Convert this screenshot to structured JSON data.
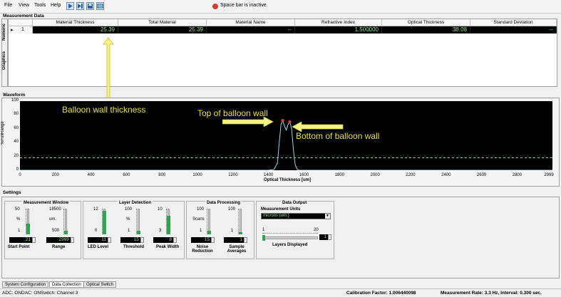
{
  "menu": {
    "file": "File",
    "view": "View",
    "tools": "Tools",
    "help": "Help"
  },
  "toolbar": {
    "icons": [
      "play-icon",
      "step-icon",
      "save-icon",
      "export-icon"
    ]
  },
  "status": {
    "text": "Space bar is inactive.",
    "dot_color": "#d93b2b"
  },
  "measurement_data": {
    "section_label": "Measurement Data",
    "tabs": {
      "numeric": "Numeric",
      "graphics": "Graphics"
    },
    "row_index": "1",
    "columns": [
      "Material Thickness",
      "Total Material",
      "Material Name",
      "Refractive Index",
      "Optical Thickness",
      "Standard Deviation"
    ],
    "values": [
      "25.39",
      "25.39",
      "--",
      "1.500000",
      "38.08",
      "--"
    ],
    "value_color": "#8fe08f"
  },
  "waveform": {
    "section_label": "Waveform",
    "annotations": {
      "wall_thickness": "Balloon wall thickness",
      "top": "Top of balloon wall",
      "bottom": "Bottom of balloon wall"
    },
    "annotation_color": "#e6e22a"
  },
  "chart_data": {
    "type": "line",
    "xlabel": "Optical Thickness [um]",
    "ylabel": "%FullRange",
    "xlim": [
      0,
      2999
    ],
    "ylim": [
      0,
      100
    ],
    "x_ticks": [
      "0",
      "200",
      "400",
      "600",
      "800",
      "1000",
      "1200",
      "1400",
      "1600",
      "1800",
      "2000",
      "2200",
      "2400",
      "2600",
      "2800",
      "2999"
    ],
    "y_ticks": [
      "0",
      "20",
      "40",
      "60",
      "80",
      "100"
    ],
    "threshold": 18,
    "series": [
      {
        "x": [
          0,
          1400,
          1430,
          1450,
          1460,
          1470,
          1480,
          1490,
          1500,
          1510,
          1520,
          1530,
          1540,
          1550,
          1560,
          1570,
          1580,
          2999
        ],
        "y": [
          0,
          0,
          1,
          10,
          40,
          66,
          72,
          64,
          58,
          66,
          70,
          60,
          30,
          8,
          2,
          0,
          0,
          0
        ]
      }
    ],
    "peaks": [
      {
        "x": 1480,
        "y": 72
      },
      {
        "x": 1520,
        "y": 70
      }
    ],
    "line_color": "#8fd6f0",
    "peak_color": "#e04040"
  },
  "settings": {
    "section_label": "Settings",
    "measurement_window": {
      "title": "Measurement Window",
      "start": {
        "label": "Start Point",
        "unit": "%",
        "max": "50",
        "min": "1",
        "value": "21",
        "level": 0.42
      },
      "range": {
        "label": "Range",
        "unit": "um.",
        "max": "18500",
        "min": "500",
        "value": "2999",
        "level": 0.14
      }
    },
    "layer_detection": {
      "title": "Layer Detection",
      "led": {
        "label": "LED Level",
        "max": "12",
        "min": "0",
        "value": "11",
        "level": 0.92
      },
      "threshold": {
        "label": "Threshold",
        "unit": "%",
        "max": "100",
        "min": "1",
        "value": "15",
        "level": 0.15
      },
      "peak_width": {
        "label": "Peak Width",
        "max": "10",
        "min": "3",
        "value": "8",
        "level": 0.72
      }
    },
    "data_processing": {
      "title": "Data Processing",
      "noise": {
        "label": "Noise Reduction",
        "unit": "Scans",
        "max": "100",
        "min": "1",
        "value": "15",
        "level": 0.15
      },
      "averages": {
        "label": "Sample Averages",
        "max": "100",
        "min": "1",
        "value": "1",
        "level": 0.02
      }
    },
    "data_output": {
      "title": "Data Output",
      "units_label": "Measurement Units",
      "units_value": "microns (um.)",
      "layers_min": "1",
      "layers_max": "20",
      "layers_value": "1",
      "layers_label": "Layers Displayed"
    }
  },
  "bottom_tabs": [
    "System Configuration",
    "Data Collection",
    "Optical Switch"
  ],
  "statusbar": {
    "adc": "ADC: ON",
    "dac": "DAC: ON",
    "switch": "Switch: Channel 3",
    "calibration": "Calibration Factor: 1.006440098",
    "rate": "Measurement Rate: 3.3 Hz, Interval: 0.300 sec."
  }
}
